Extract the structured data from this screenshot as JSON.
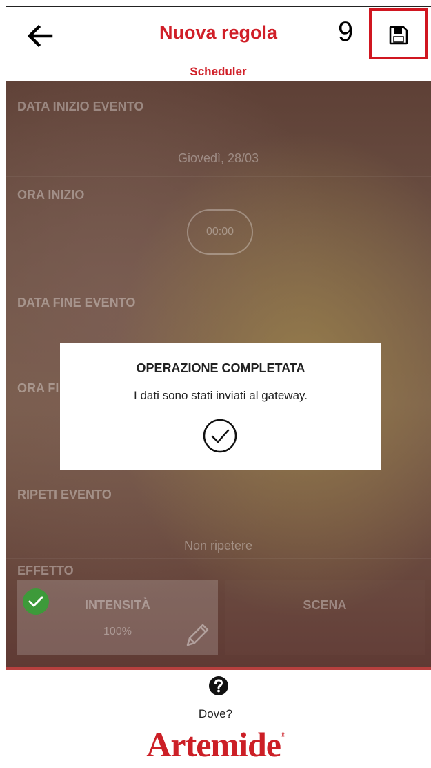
{
  "header": {
    "title": "Nuova regola",
    "step_number": "9",
    "back_icon": "arrow-left-icon",
    "save_icon": "floppy-disk-icon",
    "accent_color": "#d01f28"
  },
  "subtitle": "Scheduler",
  "sections": {
    "start_date_label": "DATA INIZIO EVENTO",
    "start_date_value": "Giovedì, 28/03",
    "start_time_label": "ORA INIZIO",
    "start_time_value": "00:00",
    "end_date_label": "DATA FINE EVENTO",
    "end_time_label": "ORA FI",
    "repeat_label": "RIPETI EVENTO",
    "repeat_value": "Non ripetere",
    "effect_label": "EFFETTO"
  },
  "effect": {
    "intensity_title": "INTENSITÀ",
    "intensity_value": "100%",
    "scene_title": "SCENA",
    "selected": "intensity"
  },
  "modal": {
    "title": "OPERAZIONE COMPLETATA",
    "message": "I dati sono stati inviati al gateway.",
    "icon": "check-circle-icon"
  },
  "footer": {
    "help_icon": "question-circle-icon",
    "where_label": "Dove?",
    "logo_text": "Artemide",
    "logo_mark": "®"
  }
}
